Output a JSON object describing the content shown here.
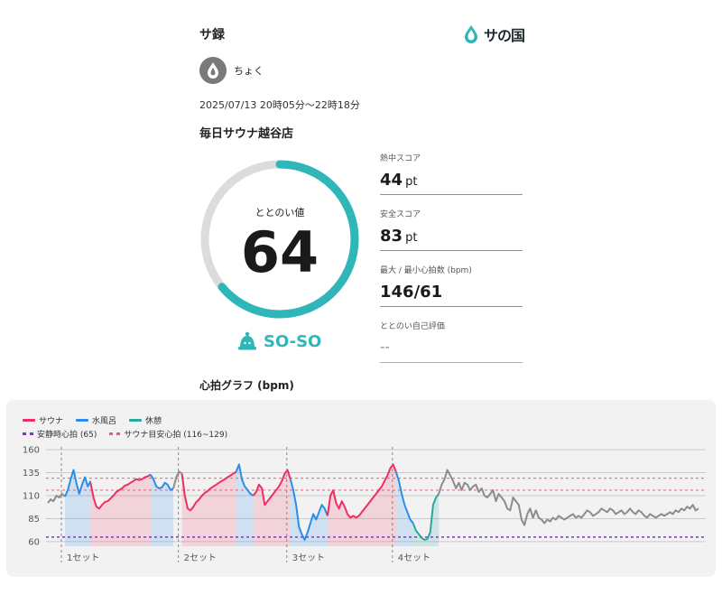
{
  "header": {
    "title": "サ録",
    "brand": "サの国"
  },
  "user": {
    "name": "ちょく"
  },
  "session": {
    "datetime": "2025/07/13 20時05分〜22時18分",
    "facility": "毎日サウナ越谷店"
  },
  "score": {
    "label": "ととのい値",
    "value": 64,
    "max": 100
  },
  "rating": {
    "text": "SO-SO"
  },
  "stats": [
    {
      "label": "熱中スコア",
      "value": "44",
      "unit": "pt"
    },
    {
      "label": "安全スコア",
      "value": "83",
      "unit": "pt"
    },
    {
      "label": "最大 / 最小心拍数 (bpm)",
      "value": "146/61",
      "unit": ""
    },
    {
      "label": "ととのい自己評価",
      "value": "--",
      "unit": ""
    }
  ],
  "graph": {
    "title": "心拍グラフ (bpm)",
    "legend": {
      "sauna": "サウナ",
      "water": "水風呂",
      "rest": "休憩",
      "resting_hr": "安静時心拍 (65)",
      "target_hr": "サウナ目安心拍 (116~129)"
    }
  },
  "chart_data": {
    "type": "line",
    "title": "",
    "ylabel": "",
    "ylim": [
      55,
      165
    ],
    "yticks": [
      60,
      85,
      110,
      135,
      160
    ],
    "resting_hr": 65,
    "target_range": [
      116,
      129
    ],
    "set_labels": [
      "1セット",
      "2セット",
      "3セット",
      "4セット"
    ],
    "colors": {
      "sauna": "#ee2f5f",
      "water": "#2a8ee8",
      "rest": "#2aa7a0",
      "other": "#8c8c8c",
      "resting": "#8a2be2",
      "target": "#ff4f7a"
    },
    "segments": [
      {
        "type": "other",
        "values": [
          102,
          106,
          104,
          110,
          108,
          112,
          109
        ]
      },
      {
        "type": "water",
        "values": [
          109,
          116,
          128,
          138,
          124,
          112,
          122,
          130,
          120,
          126
        ]
      },
      {
        "type": "sauna",
        "values": [
          124,
          108,
          98,
          96,
          100,
          103,
          104,
          107,
          110,
          114,
          116,
          118,
          121,
          122,
          124,
          126,
          128,
          127,
          128,
          130,
          131,
          133
        ]
      },
      {
        "type": "water",
        "values": [
          133,
          128,
          120,
          118,
          119,
          124,
          122,
          116,
          118
        ]
      },
      {
        "type": "other",
        "values": [
          118,
          130,
          136,
          134
        ]
      },
      {
        "type": "sauna",
        "values": [
          134,
          110,
          96,
          94,
          98,
          103,
          106,
          110,
          113,
          115,
          118,
          120,
          122,
          124,
          126,
          128,
          130,
          132,
          134,
          136
        ]
      },
      {
        "type": "water",
        "values": [
          136,
          144,
          128,
          120,
          116,
          112,
          110
        ]
      },
      {
        "type": "sauna",
        "values": [
          110,
          114,
          122,
          118,
          100,
          104,
          108,
          112,
          116,
          120,
          126,
          134,
          138,
          128
        ]
      },
      {
        "type": "water",
        "values": [
          128,
          116,
          100,
          76,
          68,
          62,
          70,
          80,
          90,
          84,
          92,
          100,
          96,
          88
        ]
      },
      {
        "type": "sauna",
        "values": [
          88,
          110,
          116,
          102,
          96,
          104,
          98,
          90,
          86,
          88,
          86,
          88,
          92,
          96,
          100,
          104,
          108,
          112,
          116,
          120,
          126,
          132,
          140,
          144,
          136
        ]
      },
      {
        "type": "water",
        "values": [
          136,
          126,
          112,
          100,
          92,
          84,
          80
        ]
      },
      {
        "type": "rest",
        "values": [
          80,
          72,
          68,
          64,
          62,
          63,
          70,
          100,
          108,
          112
        ]
      },
      {
        "type": "other",
        "values": [
          112,
          122,
          128,
          138,
          132,
          126,
          118,
          124,
          116,
          124,
          122,
          116,
          120,
          122,
          114,
          118,
          110,
          108,
          112,
          116,
          104,
          112,
          108,
          104,
          96,
          94,
          108,
          104,
          100,
          84,
          78,
          90,
          96,
          86,
          94,
          86,
          84,
          80,
          84,
          82,
          86,
          84,
          88,
          86,
          84,
          86,
          88,
          90,
          86,
          88,
          86,
          90,
          94,
          92,
          88,
          90,
          92,
          96,
          94,
          92,
          96,
          94,
          90,
          92,
          94,
          90,
          92,
          96,
          92,
          90,
          94,
          92,
          88,
          86,
          90,
          88,
          86,
          88,
          90,
          88,
          90,
          92,
          90,
          94,
          92,
          96,
          94,
          98,
          96,
          100,
          94,
          96
        ]
      }
    ]
  }
}
